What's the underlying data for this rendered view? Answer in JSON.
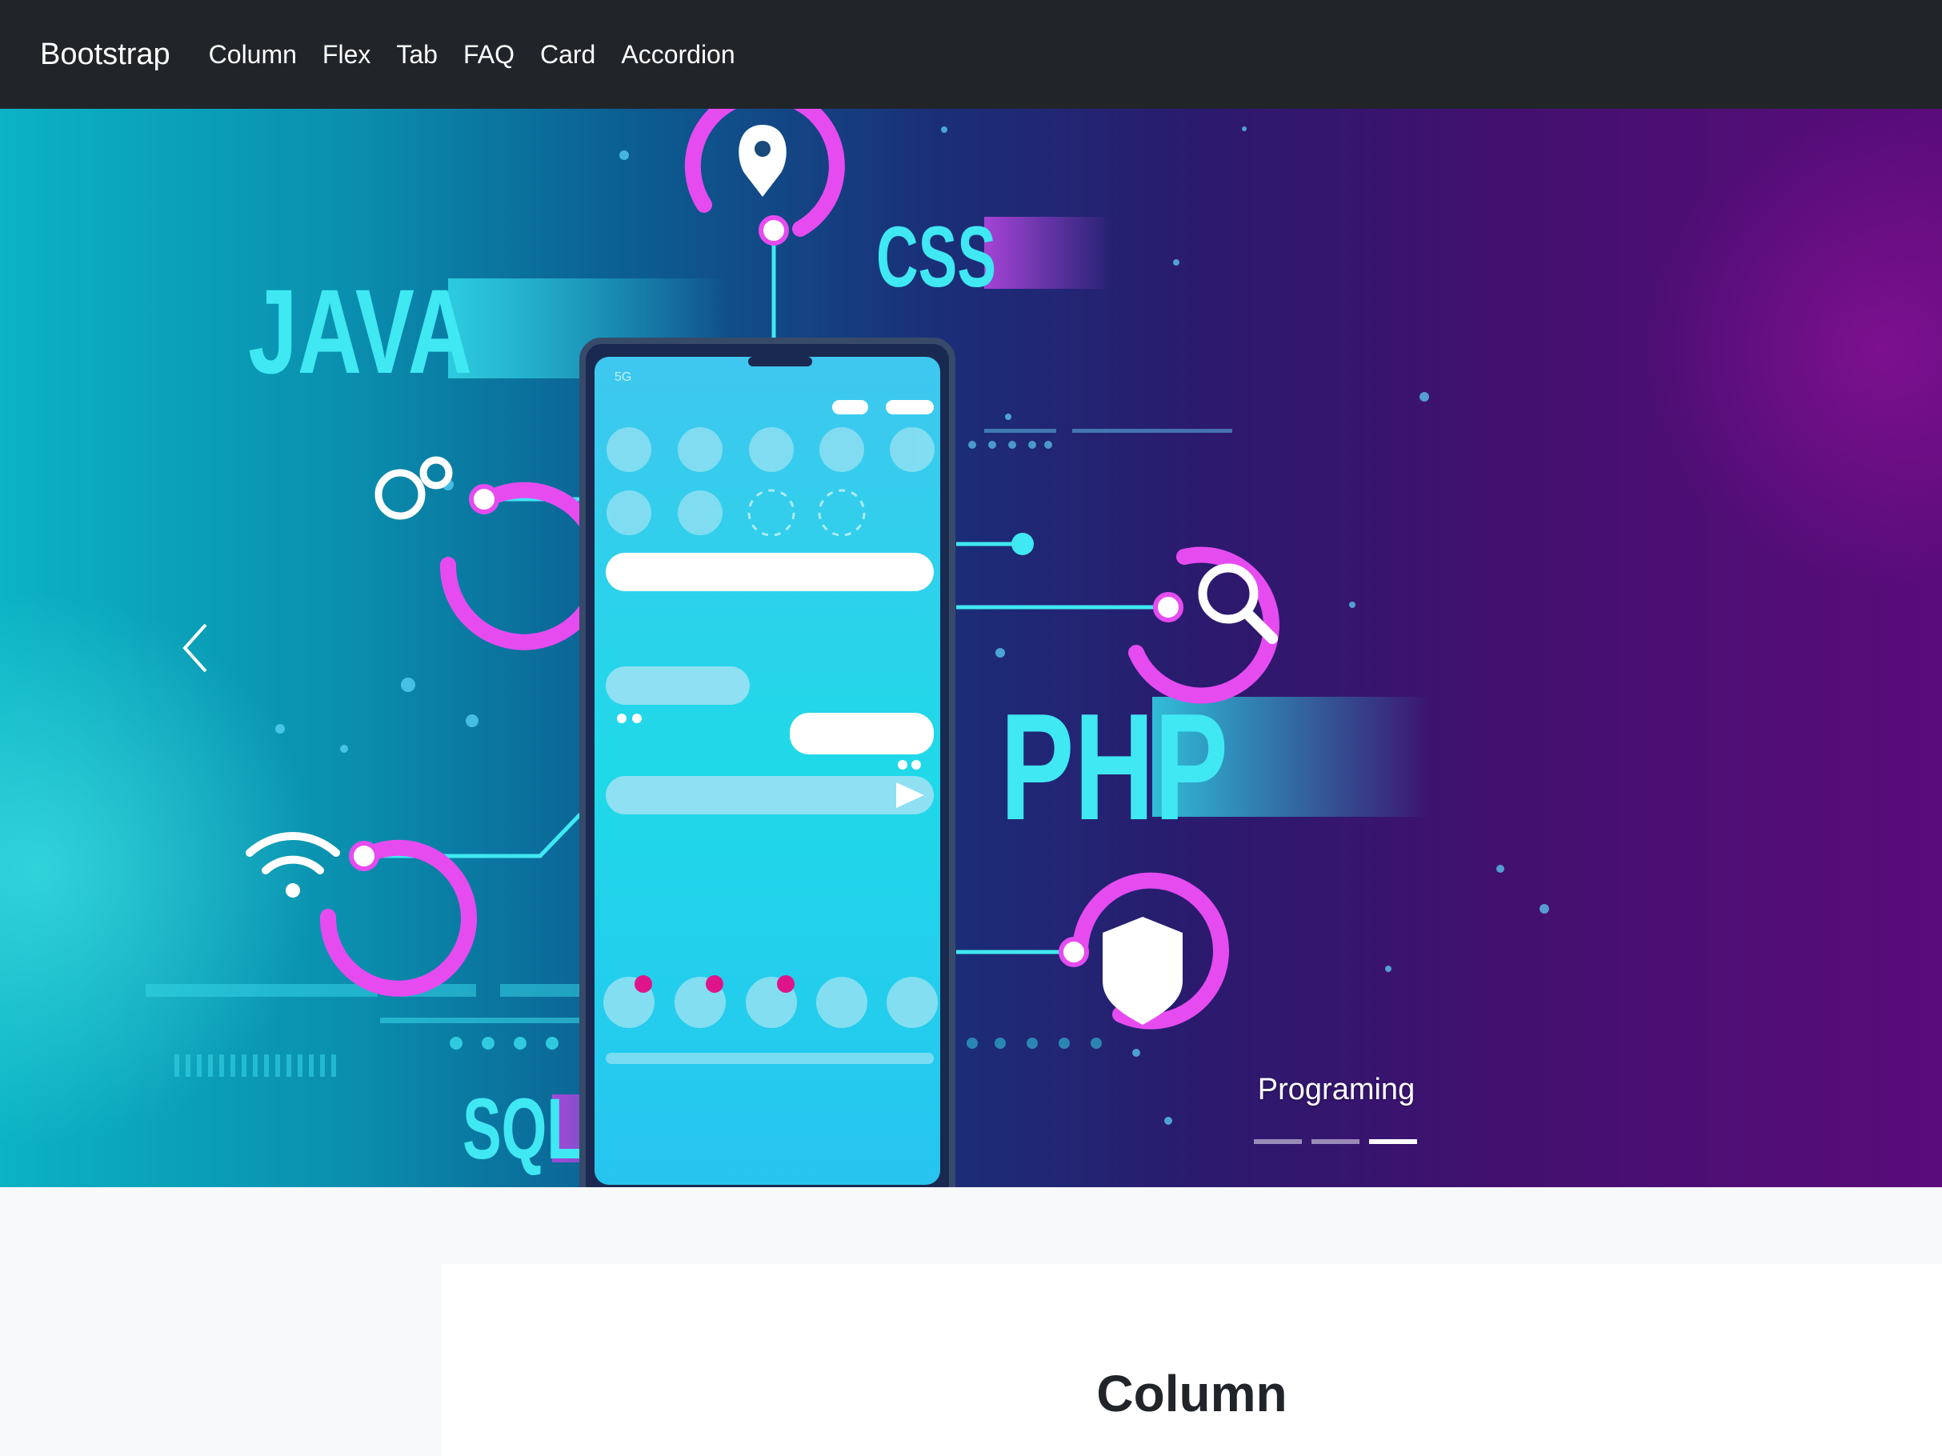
{
  "navbar": {
    "brand": "Bootstrap",
    "links": [
      "Column",
      "Flex",
      "Tab",
      "FAQ",
      "Card",
      "Accordion"
    ]
  },
  "carousel": {
    "slide_texts": {
      "java": "JAVA",
      "css": "CSS",
      "php": "PHP",
      "sql": "SQL",
      "signal": "5G"
    },
    "caption": "Programing",
    "indicator_count": 3,
    "active_indicator": 3,
    "colors": {
      "pink": "#e64bf0",
      "cyan": "#3fe8f2"
    }
  },
  "main": {
    "section_title": "Column"
  }
}
